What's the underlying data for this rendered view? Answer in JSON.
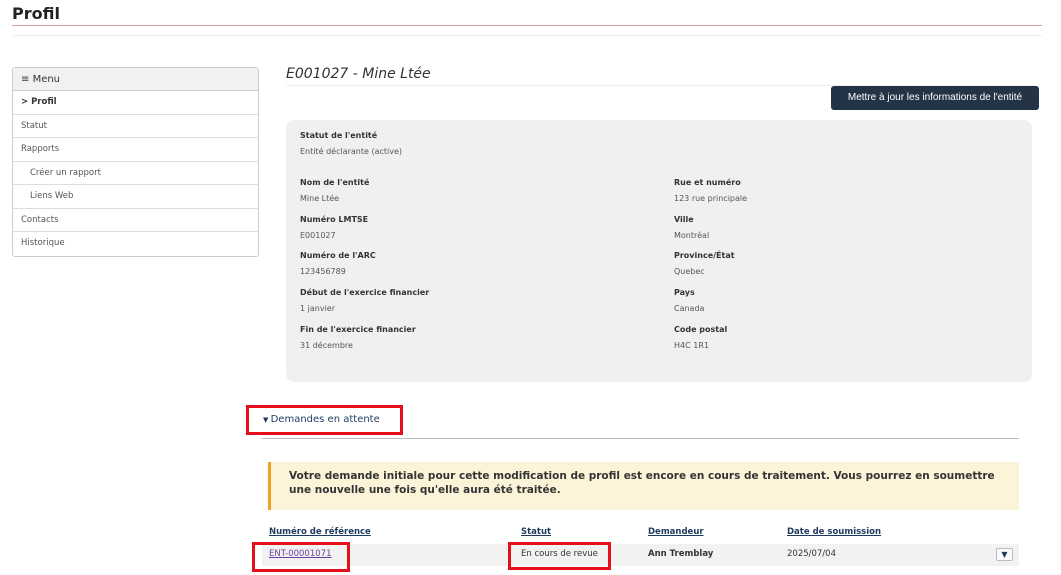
{
  "page_title": "Profil",
  "sidebar": {
    "header": "Menu",
    "items": [
      {
        "label": "> Profil"
      },
      {
        "label": "Statut"
      },
      {
        "label": "Rapports"
      },
      {
        "label": "Créer un rapport"
      },
      {
        "label": "Liens Web"
      },
      {
        "label": "Contacts"
      },
      {
        "label": "Historique"
      }
    ]
  },
  "entity": {
    "title": "E001027 - Mine Ltée",
    "update_button": "Mettre à jour les informations de l'entité",
    "status_label": "Statut de l'entité",
    "status_value": "Entité déclarante (active)",
    "left": [
      {
        "label": "Nom de l'entité",
        "value": "Mine Ltée"
      },
      {
        "label": "Numéro LMTSE",
        "value": "E001027"
      },
      {
        "label": "Numéro de l'ARC",
        "value": "123456789"
      },
      {
        "label": "Début de l'exercice financier",
        "value": "1 janvier"
      },
      {
        "label": "Fin de l'exercice financier",
        "value": "31 décembre"
      }
    ],
    "right": [
      {
        "label": "Rue et numéro",
        "value": "123 rue principale"
      },
      {
        "label": "Ville",
        "value": "Montréal"
      },
      {
        "label": "Province/État",
        "value": "Quebec"
      },
      {
        "label": "Pays",
        "value": "Canada"
      },
      {
        "label": "Code postal",
        "value": "H4C 1R1"
      }
    ]
  },
  "pending": {
    "toggle": "Demandes en attente",
    "alert": "Votre demande initiale pour cette modification de profil est encore en cours de traitement. Vous pourrez en soumettre une nouvelle une fois qu'elle aura été traitée.",
    "columns": [
      "Numéro de référence",
      "Statut",
      "Demandeur",
      "Date de soumission"
    ],
    "rows": [
      {
        "ref": "ENT-00001071",
        "status": "En cours de revue",
        "requester": "Ann Tremblay",
        "date": "2025/07/04"
      }
    ]
  },
  "colors": {
    "primary_button": "#243447",
    "highlight": "#e3101c",
    "alert_border": "#f0a020"
  }
}
